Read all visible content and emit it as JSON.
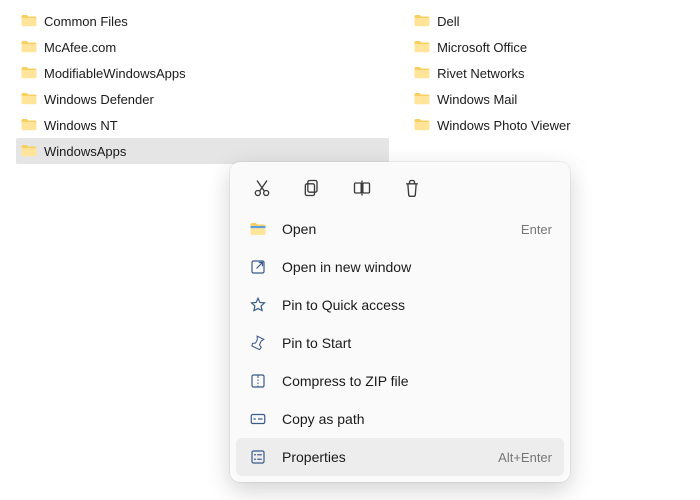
{
  "folders": {
    "left": [
      {
        "name": "Common Files",
        "selected": false
      },
      {
        "name": "McAfee.com",
        "selected": false
      },
      {
        "name": "ModifiableWindowsApps",
        "selected": false
      },
      {
        "name": "Windows Defender",
        "selected": false
      },
      {
        "name": "Windows NT",
        "selected": false
      },
      {
        "name": "WindowsApps",
        "selected": true
      }
    ],
    "right": [
      {
        "name": "Dell"
      },
      {
        "name": "Microsoft Office"
      },
      {
        "name": "Rivet Networks"
      },
      {
        "name": "Windows Mail"
      },
      {
        "name": "Windows Photo Viewer"
      }
    ]
  },
  "context_menu": {
    "toprow": [
      "cut",
      "copy",
      "rename",
      "delete"
    ],
    "items": [
      {
        "icon": "folder-open",
        "label": "Open",
        "shortcut": "Enter",
        "hover": false
      },
      {
        "icon": "external",
        "label": "Open in new window",
        "shortcut": "",
        "hover": false
      },
      {
        "icon": "star",
        "label": "Pin to Quick access",
        "shortcut": "",
        "hover": false
      },
      {
        "icon": "pin",
        "label": "Pin to Start",
        "shortcut": "",
        "hover": false
      },
      {
        "icon": "zip",
        "label": "Compress to ZIP file",
        "shortcut": "",
        "hover": false
      },
      {
        "icon": "copypath",
        "label": "Copy as path",
        "shortcut": "",
        "hover": false
      },
      {
        "icon": "properties",
        "label": "Properties",
        "shortcut": "Alt+Enter",
        "hover": true
      }
    ]
  }
}
